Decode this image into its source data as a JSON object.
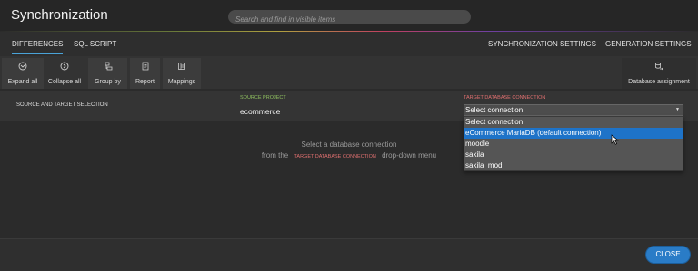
{
  "window": {
    "title": "Synchronization"
  },
  "search": {
    "placeholder": "Search and find in visible items"
  },
  "tabs": [
    {
      "label": "DIFFERENCES",
      "active": true
    },
    {
      "label": "SQL SCRIPT",
      "active": false
    },
    {
      "label": "SYNCHRONIZATION SETTINGS",
      "active": false
    },
    {
      "label": "GENERATION SETTINGS",
      "active": false
    }
  ],
  "toolbar": {
    "expand_all": {
      "label": "Expand all",
      "icon": "chevron-down-circle-icon"
    },
    "collapse_all": {
      "label": "Collapse all",
      "icon": "chevron-right-circle-icon"
    },
    "group_by": {
      "label": "Group by",
      "icon": "group-icon"
    },
    "report": {
      "label": "Report",
      "icon": "report-icon"
    },
    "mappings": {
      "label": "Mappings",
      "icon": "mappings-icon"
    },
    "database_assignment": {
      "label": "Database assignment",
      "icon": "database-assignment-icon"
    }
  },
  "selection": {
    "title": "SOURCE AND TARGET SELECTION",
    "source_label": "SOURCE PROJECT",
    "source_value": "ecommerce",
    "target_label": "TARGET DATABASE CONNECTION",
    "target_value": "Select connection",
    "options": [
      "Select connection",
      "eCommerce MariaDB (default connection)",
      "moodle",
      "sakila",
      "sakila_mod"
    ],
    "hovered_option": "eCommerce MariaDB (default connection)"
  },
  "empty_state": {
    "line1": "Select a database connection",
    "line2_prefix": "from the",
    "line2_highlight": "TARGET DATABASE CONNECTION",
    "line2_suffix": "drop-down menu"
  },
  "footer": {
    "close_label": "CLOSE"
  },
  "colors": {
    "accent": "#2a7cc7",
    "source_label": "#8fc060",
    "target_label": "#e07070",
    "hover": "#1e73c8"
  }
}
